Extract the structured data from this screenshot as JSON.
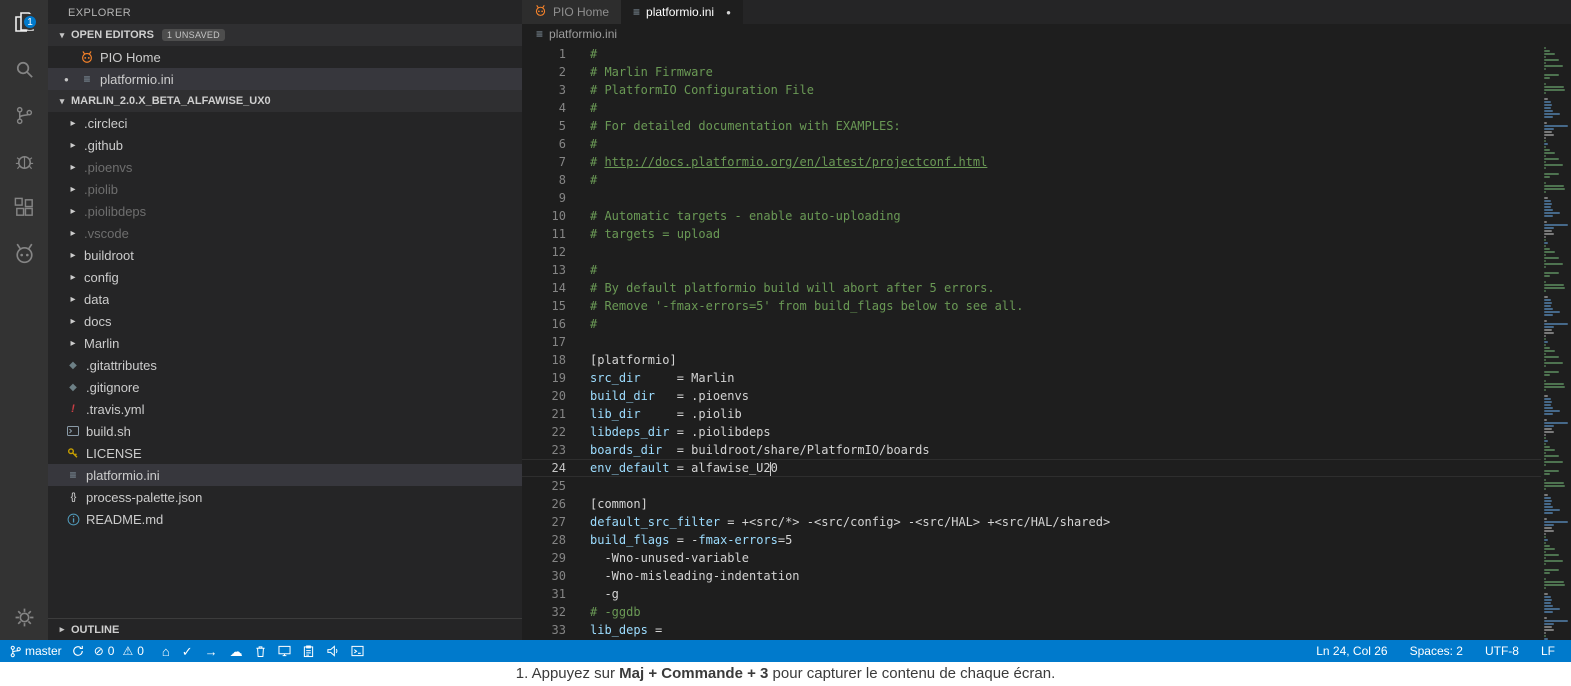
{
  "activity_bar": {
    "badge": "1"
  },
  "explorer": {
    "title": "EXPLORER",
    "open_editors": {
      "label": "OPEN EDITORS",
      "badge": "1 UNSAVED",
      "items": [
        {
          "label": "PIO Home",
          "icon": "platformio"
        },
        {
          "label": "platformio.ini",
          "icon": "ini",
          "modified": true
        }
      ]
    },
    "project_label": "MARLIN_2.0.X_BETA_ALFAWISE_UX0",
    "tree": [
      {
        "label": ".circleci",
        "type": "folder"
      },
      {
        "label": ".github",
        "type": "folder"
      },
      {
        "label": ".pioenvs",
        "type": "folder",
        "dim": true
      },
      {
        "label": ".piolib",
        "type": "folder",
        "dim": true
      },
      {
        "label": ".piolibdeps",
        "type": "folder",
        "dim": true
      },
      {
        "label": ".vscode",
        "type": "folder",
        "dim": true
      },
      {
        "label": "buildroot",
        "type": "folder"
      },
      {
        "label": "config",
        "type": "folder"
      },
      {
        "label": "data",
        "type": "folder"
      },
      {
        "label": "docs",
        "type": "folder"
      },
      {
        "label": "Marlin",
        "type": "folder"
      },
      {
        "label": ".gitattributes",
        "type": "file",
        "icon": "git"
      },
      {
        "label": ".gitignore",
        "type": "file",
        "icon": "git"
      },
      {
        "label": ".travis.yml",
        "type": "file",
        "icon": "travis"
      },
      {
        "label": "build.sh",
        "type": "file",
        "icon": "shell"
      },
      {
        "label": "LICENSE",
        "type": "file",
        "icon": "license"
      },
      {
        "label": "platformio.ini",
        "type": "file",
        "icon": "ini",
        "selected": true
      },
      {
        "label": "process-palette.json",
        "type": "file",
        "icon": "json"
      },
      {
        "label": "README.md",
        "type": "file",
        "icon": "readme"
      }
    ],
    "outline_label": "OUTLINE"
  },
  "tabs": [
    {
      "label": "PIO Home",
      "active": false
    },
    {
      "label": "platformio.ini",
      "active": true,
      "modified": true
    }
  ],
  "breadcrumb": {
    "file": "platformio.ini"
  },
  "editor": {
    "lines": [
      {
        "n": 1,
        "s": [
          [
            "c",
            "#"
          ]
        ]
      },
      {
        "n": 2,
        "s": [
          [
            "c",
            "# Marlin Firmware"
          ]
        ]
      },
      {
        "n": 3,
        "s": [
          [
            "c",
            "# PlatformIO Configuration File"
          ]
        ]
      },
      {
        "n": 4,
        "s": [
          [
            "c",
            "#"
          ]
        ]
      },
      {
        "n": 5,
        "s": [
          [
            "c",
            "# For detailed documentation with EXAMPLES:"
          ]
        ]
      },
      {
        "n": 6,
        "s": [
          [
            "c",
            "#"
          ]
        ]
      },
      {
        "n": 7,
        "s": [
          [
            "c",
            "# "
          ],
          [
            "l",
            "http://docs.platformio.org/en/latest/projectconf.html"
          ]
        ]
      },
      {
        "n": 8,
        "s": [
          [
            "c",
            "#"
          ]
        ]
      },
      {
        "n": 9,
        "s": []
      },
      {
        "n": 10,
        "s": [
          [
            "c",
            "# Automatic targets - enable auto-uploading"
          ]
        ]
      },
      {
        "n": 11,
        "s": [
          [
            "c",
            "# targets = upload"
          ]
        ]
      },
      {
        "n": 12,
        "s": []
      },
      {
        "n": 13,
        "s": [
          [
            "c",
            "#"
          ]
        ]
      },
      {
        "n": 14,
        "s": [
          [
            "c",
            "# By default platformio build will abort after 5 errors."
          ]
        ]
      },
      {
        "n": 15,
        "s": [
          [
            "c",
            "# Remove '-fmax-errors=5' from build_flags below to see all."
          ]
        ]
      },
      {
        "n": 16,
        "s": [
          [
            "c",
            "#"
          ]
        ]
      },
      {
        "n": 17,
        "s": []
      },
      {
        "n": 18,
        "s": [
          [
            "d",
            "[platformio]"
          ]
        ]
      },
      {
        "n": 19,
        "s": [
          [
            "k",
            "src_dir"
          ],
          [
            "d",
            "     = Marlin"
          ]
        ]
      },
      {
        "n": 20,
        "s": [
          [
            "k",
            "build_dir"
          ],
          [
            "d",
            "   = .pioenvs"
          ]
        ]
      },
      {
        "n": 21,
        "s": [
          [
            "k",
            "lib_dir"
          ],
          [
            "d",
            "     = .piolib"
          ]
        ]
      },
      {
        "n": 22,
        "s": [
          [
            "k",
            "libdeps_dir"
          ],
          [
            "d",
            " = .piolibdeps"
          ]
        ]
      },
      {
        "n": 23,
        "s": [
          [
            "k",
            "boards_dir"
          ],
          [
            "d",
            "  = buildroot/share/PlatformIO/boards"
          ]
        ]
      },
      {
        "n": 24,
        "current": true,
        "s": [
          [
            "k",
            "env_default"
          ],
          [
            "d",
            " = alfawise_U2"
          ],
          [
            "cur",
            ""
          ],
          [
            "d",
            "0"
          ]
        ]
      },
      {
        "n": 25,
        "s": []
      },
      {
        "n": 26,
        "s": [
          [
            "d",
            "[common]"
          ]
        ]
      },
      {
        "n": 27,
        "s": [
          [
            "k",
            "default_src_filter"
          ],
          [
            "d",
            " = +<src/*> -<src/config> -<src/HAL> +<src/HAL/shared>"
          ]
        ]
      },
      {
        "n": 28,
        "s": [
          [
            "k",
            "build_flags"
          ],
          [
            "d",
            " = -"
          ],
          [
            "k",
            "fmax-errors"
          ],
          [
            "d",
            "=5"
          ]
        ]
      },
      {
        "n": 29,
        "s": [
          [
            "d",
            "  -Wno-unused-variable"
          ]
        ]
      },
      {
        "n": 30,
        "s": [
          [
            "d",
            "  -Wno-misleading-indentation"
          ]
        ]
      },
      {
        "n": 31,
        "s": [
          [
            "d",
            "  -g"
          ]
        ]
      },
      {
        "n": 32,
        "s": [
          [
            "c",
            "# -ggdb"
          ]
        ]
      },
      {
        "n": 33,
        "s": [
          [
            "k",
            "lib_deps"
          ],
          [
            "d",
            " ="
          ]
        ]
      }
    ]
  },
  "status_bar": {
    "branch": "master",
    "errors": "0",
    "warnings": "0",
    "line_col": "Ln 24, Col 26",
    "spaces": "Spaces: 2",
    "encoding": "UTF-8",
    "eol": "LF"
  },
  "overlay": {
    "prefix": "1. Appuyez sur ",
    "shortcut": "Maj + Commande + 3",
    "suffix": " pour capturer le contenu de chaque écran."
  }
}
